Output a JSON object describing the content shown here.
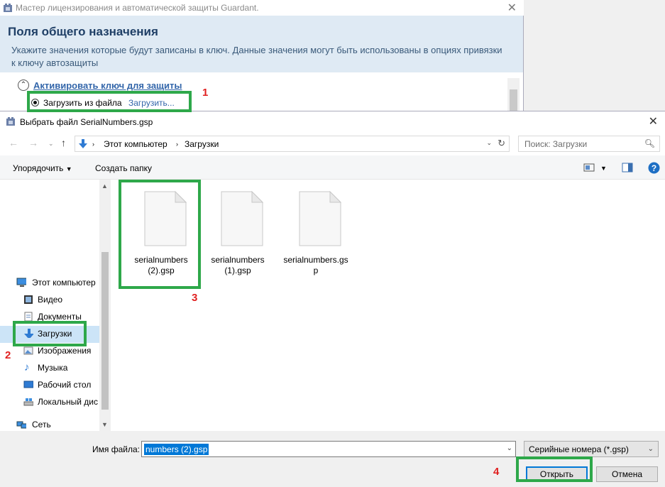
{
  "wizard": {
    "title": "Мастер лицензирования и автоматической защиты Guardant.",
    "heading": "Поля общего назначения",
    "description": "Укажите значения которые будут записаны в ключ. Данные значения могут быть использованы в опциях привязки к ключу автозащиты",
    "section_title": "Активировать ключ для защиты",
    "radio_label": "Загрузить из файла",
    "load_link": "Загрузить..."
  },
  "dialog": {
    "title": "Выбрать файл SerialNumbers.gsp",
    "breadcrumbs": [
      "Этот компьютер",
      "Загрузки"
    ],
    "search_placeholder": "Поиск: Загрузки",
    "toolbar": {
      "organize": "Упорядочить",
      "new_folder": "Создать папку"
    },
    "sidebar": {
      "items": [
        {
          "label": "Этот компьютер",
          "icon": "computer-icon"
        },
        {
          "label": "Видео",
          "icon": "video-icon"
        },
        {
          "label": "Документы",
          "icon": "documents-icon"
        },
        {
          "label": "Загрузки",
          "icon": "downloads-icon",
          "selected": true
        },
        {
          "label": "Изображения",
          "icon": "pictures-icon"
        },
        {
          "label": "Музыка",
          "icon": "music-icon"
        },
        {
          "label": "Рабочий стол",
          "icon": "desktop-icon"
        },
        {
          "label": "Локальный дис",
          "icon": "drive-icon"
        },
        {
          "label": "Сеть",
          "icon": "network-icon"
        }
      ]
    },
    "files": [
      {
        "name": "serialnumbers (2).gsp"
      },
      {
        "name": "serialnumbers (1).gsp"
      },
      {
        "name": "serialnumbers.gsp"
      }
    ],
    "filename_label": "Имя файла:",
    "filename_value": "numbers (2).gsp",
    "filetype": "Серийные номера (*.gsp)",
    "open_button": "Открыть",
    "cancel_button": "Отмена"
  },
  "annotations": {
    "n1": "1",
    "n2": "2",
    "n3": "3",
    "n4": "4",
    "highlight_color": "#2ea84a",
    "number_color": "#e02020"
  }
}
